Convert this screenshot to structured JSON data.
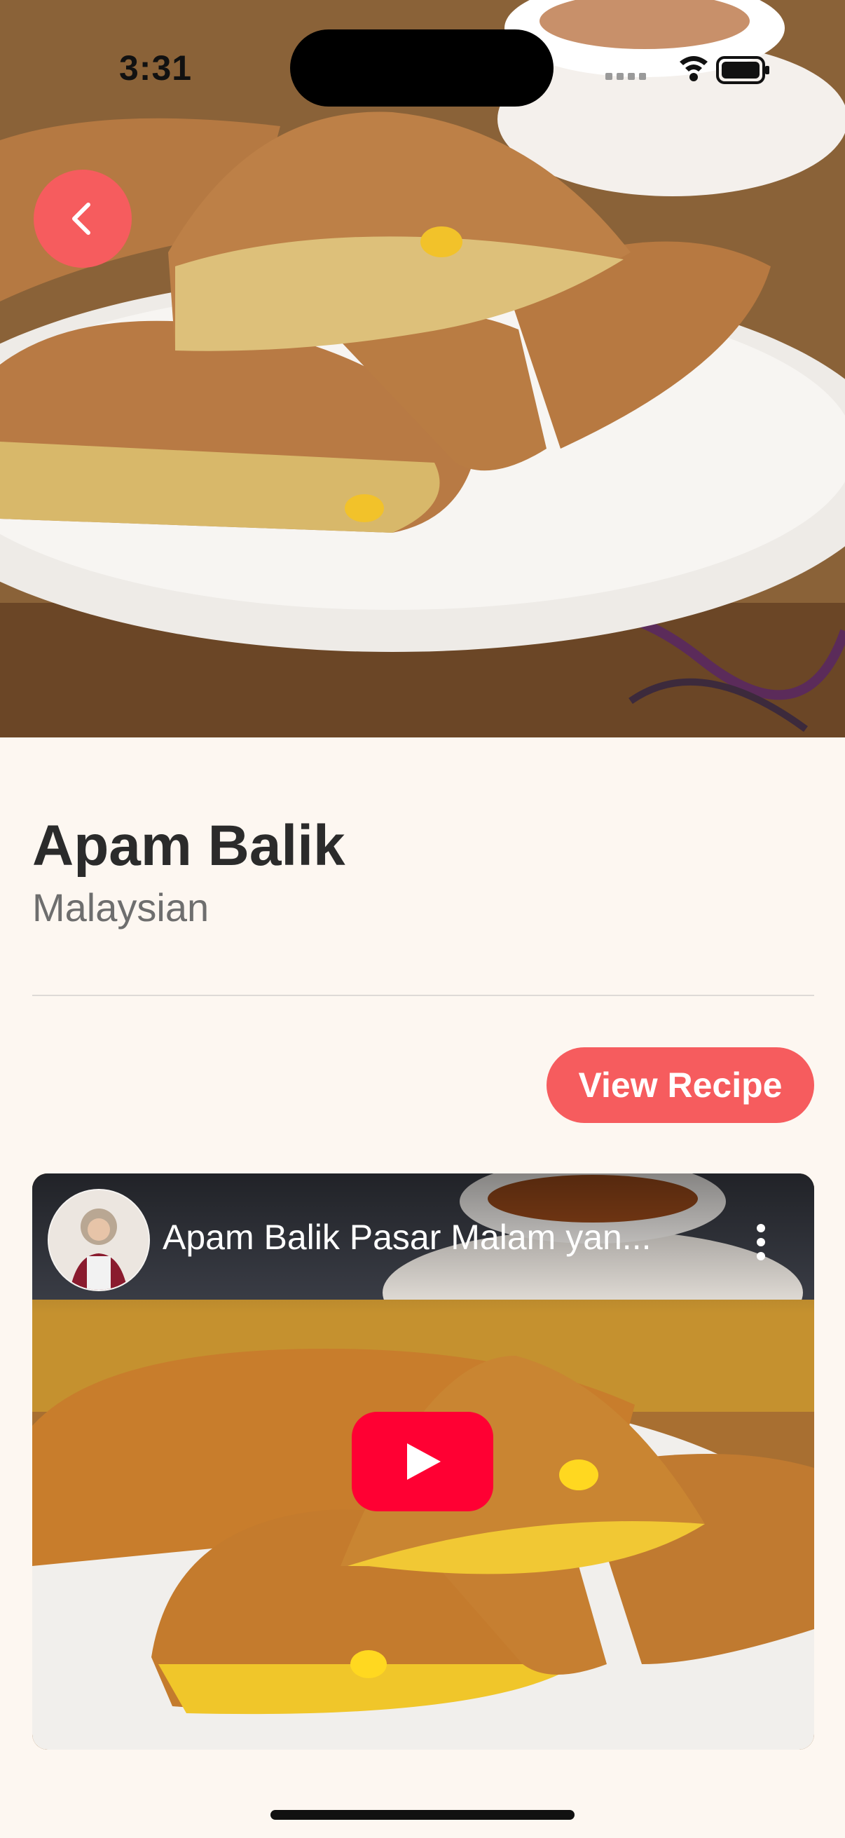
{
  "status_bar": {
    "time": "3:31"
  },
  "recipe": {
    "title": "Apam Balik",
    "cuisine": "Malaysian",
    "view_recipe_label": "View Recipe"
  },
  "video": {
    "title": "Apam Balik Pasar Malam yan..."
  },
  "colors": {
    "accent": "#F65C5E",
    "background": "#FDF7F1",
    "youtube_red": "#FF0033"
  },
  "icons": {
    "back": "chevron-left-icon",
    "play": "play-icon",
    "more": "more-vertical-icon",
    "wifi": "wifi-icon",
    "battery": "battery-icon",
    "signal": "cellular-signal-icon"
  }
}
